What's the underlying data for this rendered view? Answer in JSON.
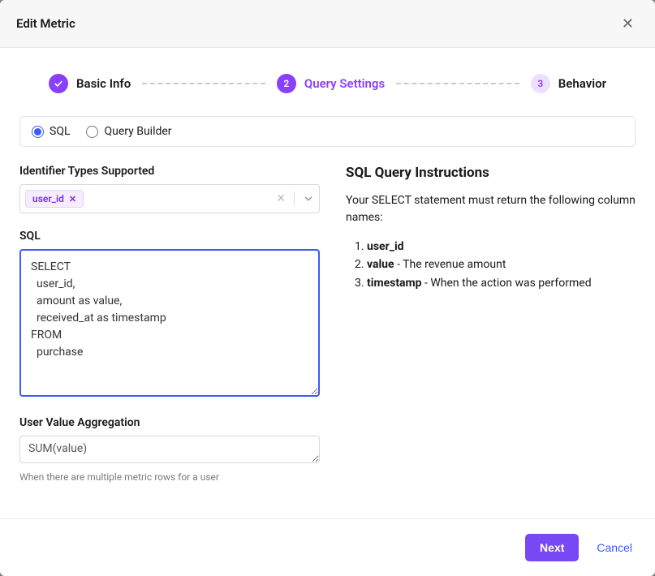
{
  "header": {
    "title": "Edit Metric"
  },
  "stepper": {
    "steps": [
      {
        "label": "Basic Info",
        "state": "done"
      },
      {
        "label": "Query Settings",
        "state": "active"
      },
      {
        "label": "Behavior",
        "state": "pending",
        "number": "3"
      }
    ],
    "active_number": "2"
  },
  "mode": {
    "sql_label": "SQL",
    "qb_label": "Query Builder"
  },
  "form": {
    "identifier_label": "Identifier Types Supported",
    "identifier_tags": [
      "user_id"
    ],
    "sql_label": "SQL",
    "sql_value": "SELECT\n  user_id,\n  amount as value,\n  received_at as timestamp\nFROM\n  purchase",
    "agg_label": "User Value Aggregation",
    "agg_value": "SUM(value)",
    "agg_help": "When there are multiple metric rows for a user"
  },
  "instructions": {
    "title": "SQL Query Instructions",
    "intro": "Your SELECT statement must return the following column names:",
    "items": [
      {
        "bold": "user_id",
        "rest": ""
      },
      {
        "bold": "value",
        "rest": " - The revenue amount"
      },
      {
        "bold": "timestamp",
        "rest": " - When the action was performed"
      }
    ]
  },
  "footer": {
    "next": "Next",
    "cancel": "Cancel"
  }
}
